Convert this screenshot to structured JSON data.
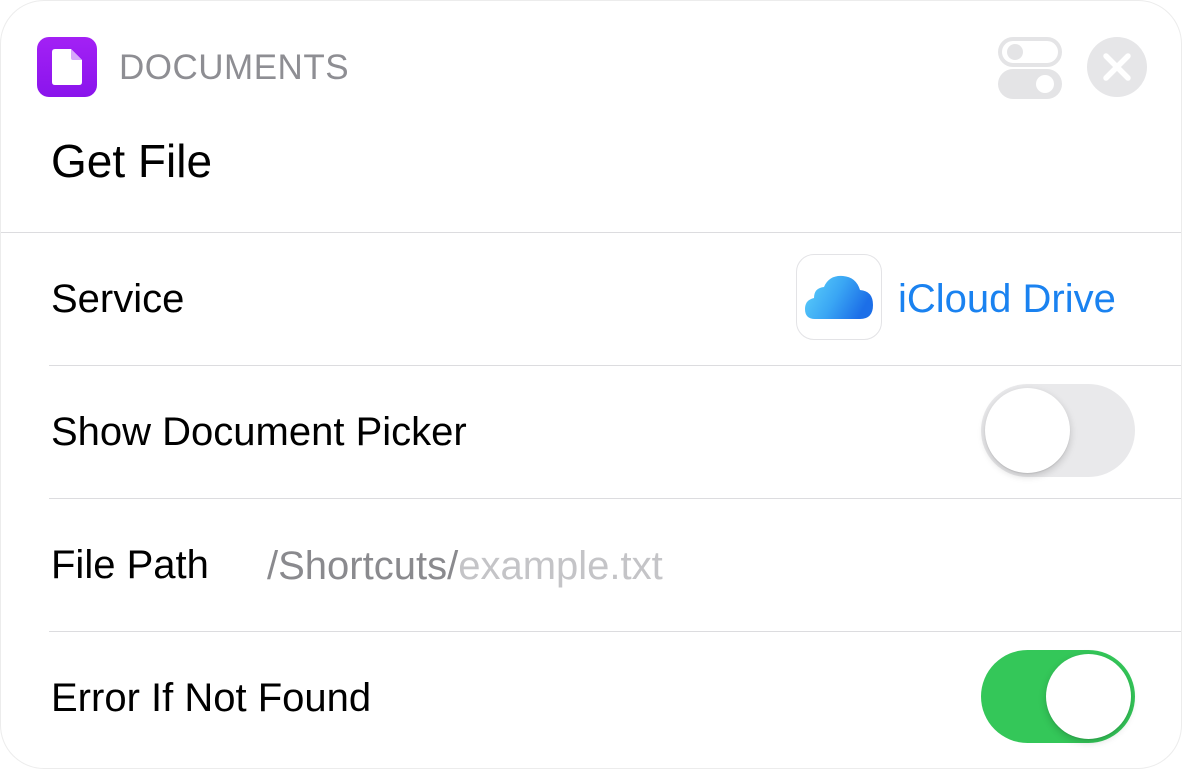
{
  "header": {
    "app_name": "DOCUMENTS",
    "app_icon": "document-icon",
    "app_color": "#9a1df2",
    "settings_icon": "toggles-icon",
    "close_icon": "close-icon"
  },
  "action": {
    "title": "Get File"
  },
  "rows": {
    "service": {
      "label": "Service",
      "value": "iCloud Drive",
      "icon": "icloud-icon",
      "value_color": "#1a82f0"
    },
    "show_picker": {
      "label": "Show Document Picker",
      "toggle_on": false
    },
    "file_path": {
      "label": "File Path",
      "prefix": "/Shortcuts/",
      "placeholder": "example.txt"
    },
    "error_if_not_found": {
      "label": "Error If Not Found",
      "toggle_on": true,
      "on_color": "#34c759"
    }
  }
}
